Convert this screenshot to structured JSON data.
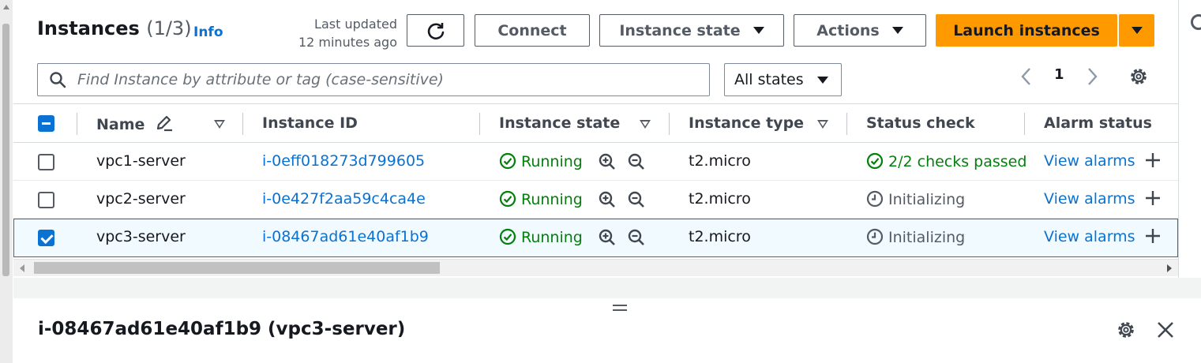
{
  "header": {
    "title": "Instances",
    "count": "(1/3)",
    "info_label": "Info",
    "last_updated_line1": "Last updated",
    "last_updated_line2": "12 minutes ago"
  },
  "toolbar": {
    "connect_label": "Connect",
    "instance_state_label": "Instance state",
    "actions_label": "Actions",
    "launch_label": "Launch instances"
  },
  "search": {
    "placeholder": "Find Instance by attribute or tag (case-sensitive)",
    "value": ""
  },
  "filter": {
    "selected": "All states"
  },
  "pagination": {
    "current_page": "1"
  },
  "table": {
    "columns": [
      "Name",
      "Instance ID",
      "Instance state",
      "Instance type",
      "Status check",
      "Alarm status"
    ],
    "rows": [
      {
        "selected": false,
        "name": "vpc1-server",
        "id": "i-0eff018273d799605",
        "state": "Running",
        "type": "t2.micro",
        "status": "2/2 checks passed",
        "status_kind": "ok",
        "alarm": "View alarms"
      },
      {
        "selected": false,
        "name": "vpc2-server",
        "id": "i-0e427f2aa59c4ca4e",
        "state": "Running",
        "type": "t2.micro",
        "status": "Initializing",
        "status_kind": "pending",
        "alarm": "View alarms"
      },
      {
        "selected": true,
        "name": "vpc3-server",
        "id": "i-08467ad61e40af1b9",
        "state": "Running",
        "type": "t2.micro",
        "status": "Initializing",
        "status_kind": "pending",
        "alarm": "View alarms"
      }
    ]
  },
  "details": {
    "title": "i-08467ad61e40af1b9 (vpc3-server)"
  },
  "colors": {
    "primary": "#ff9900",
    "link": "#0972d3",
    "success": "#037f0c",
    "text": "#16191f",
    "muted": "#545b64"
  },
  "icons": [
    "refresh-icon",
    "caret-down-icon",
    "search-icon",
    "chevron-left-icon",
    "chevron-right-icon",
    "settings-gear-icon",
    "edit-pencil-icon",
    "sort-caret-icon",
    "check-circle-icon",
    "zoom-in-icon",
    "zoom-out-icon",
    "clock-icon",
    "plus-icon",
    "close-icon",
    "drag-handle-icon"
  ]
}
